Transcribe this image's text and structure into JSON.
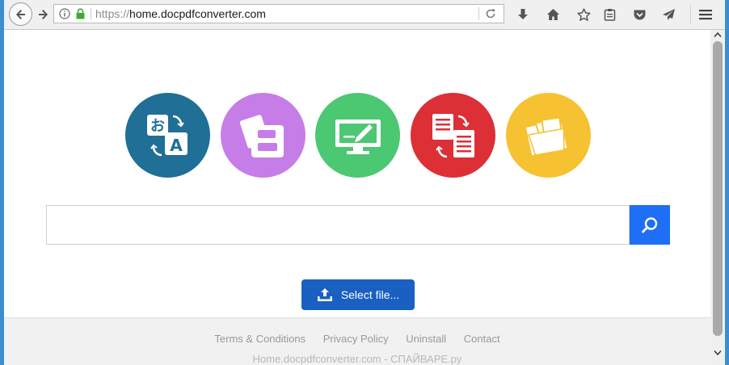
{
  "browser": {
    "url_protocol": "https://",
    "url_host": "home.docpdfconverter.com"
  },
  "page": {
    "feature_icons": [
      {
        "name": "translate-icon",
        "color": "#1f6f96"
      },
      {
        "name": "files-icon",
        "color": "#c77de8"
      },
      {
        "name": "monitor-edit-icon",
        "color": "#4cc772"
      },
      {
        "name": "document-convert-icon",
        "color": "#dd2f36"
      },
      {
        "name": "folder-icon",
        "color": "#f6c232"
      }
    ],
    "search": {
      "value": "",
      "placeholder": ""
    },
    "select_file_label": "Select file..."
  },
  "footer": {
    "links": [
      "Terms & Conditions",
      "Privacy Policy",
      "Uninstall",
      "Contact"
    ],
    "watermark": "Home.docpdfconverter.com - СПАЙВАРЕ.ру"
  }
}
